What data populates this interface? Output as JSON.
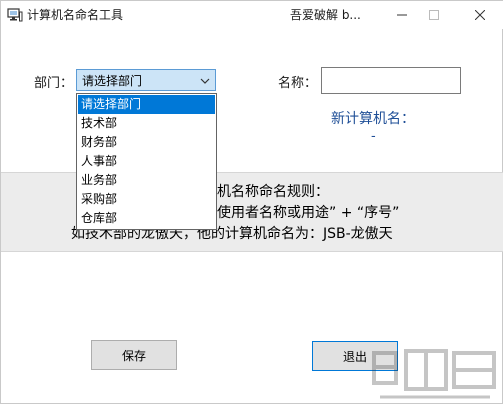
{
  "window": {
    "title": "计算机名命名工具",
    "title_extra": "吾爱破解 b..."
  },
  "form": {
    "department_label": "部门：",
    "department_selected": "请选择部门",
    "name_label": "名称：",
    "name_value": "",
    "new_name_label": "新计算机名：",
    "new_name_value": "-"
  },
  "dropdown": {
    "options": [
      "请选择部门",
      "技术部",
      "财务部",
      "人事部",
      "业务部",
      "采购部",
      "仓库部"
    ],
    "selected_index": 0
  },
  "rules": {
    "line1": "机名称命名规则：",
    "line2": "使用者名称或用途” + “序号”",
    "line3": "如技术部的龙傲天，他的计算机命名为：JSB-龙傲天"
  },
  "buttons": {
    "save": "保存",
    "exit": "退出"
  },
  "colors": {
    "selection": "#0078d7",
    "combo_bg": "#cce4f7",
    "new_name_text": "#1f4f97"
  },
  "icons": {
    "app": "computer-icon",
    "dropdown": "chevron-down-icon"
  }
}
